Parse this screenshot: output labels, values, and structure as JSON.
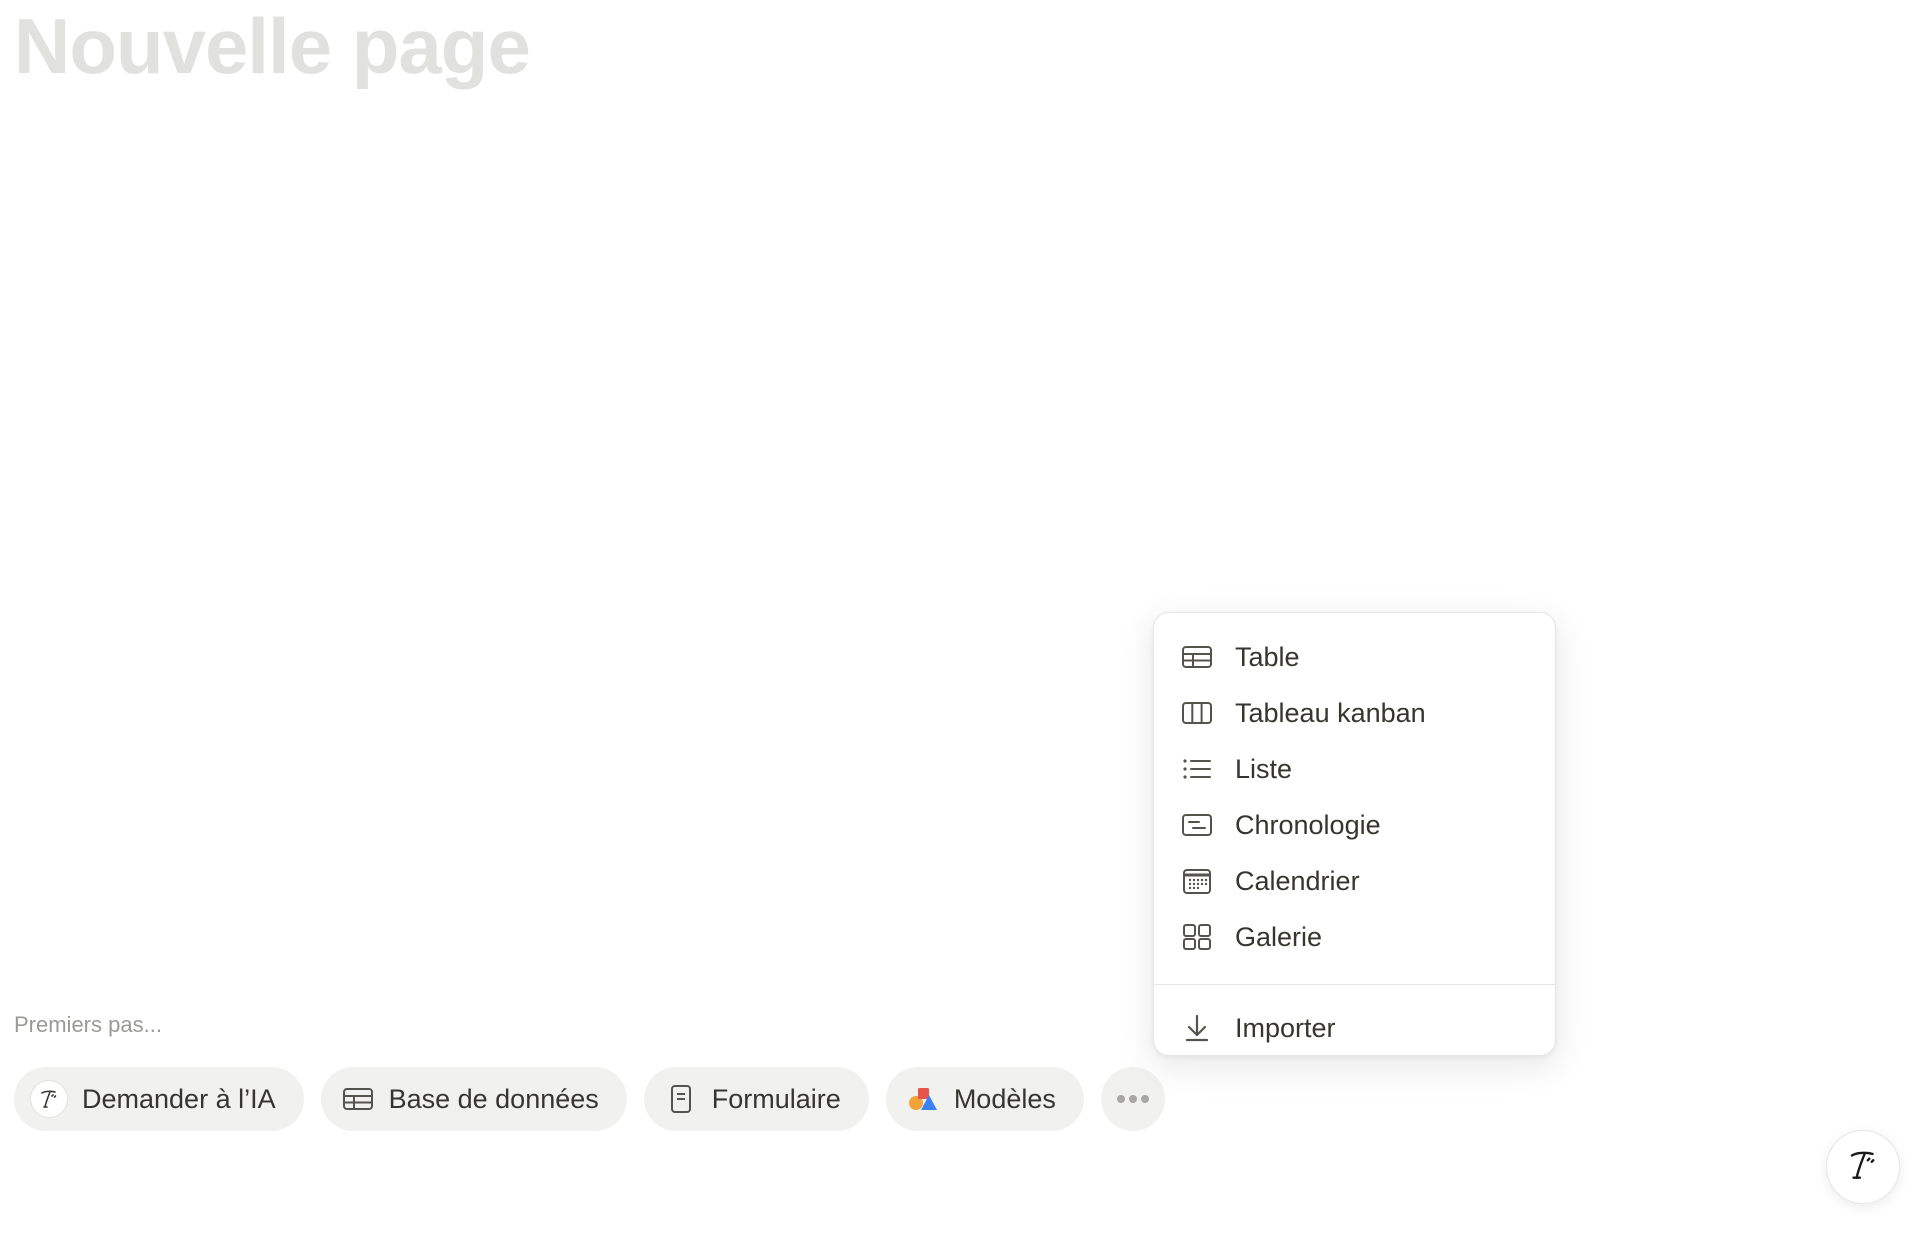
{
  "page": {
    "title": "Nouvelle page",
    "getting_started_label": "Premiers pas..."
  },
  "chips": [
    {
      "label": "Demander à l’IA",
      "icon": "ai-face-icon"
    },
    {
      "label": "Base de données",
      "icon": "table-icon"
    },
    {
      "label": "Formulaire",
      "icon": "form-icon"
    },
    {
      "label": "Modèles",
      "icon": "templates-icon"
    }
  ],
  "more_button": {
    "icon": "more-dots-icon"
  },
  "menu": {
    "items": [
      {
        "label": "Table",
        "icon": "table-icon"
      },
      {
        "label": "Tableau kanban",
        "icon": "board-icon"
      },
      {
        "label": "Liste",
        "icon": "list-icon"
      },
      {
        "label": "Chronologie",
        "icon": "timeline-icon"
      },
      {
        "label": "Calendrier",
        "icon": "calendar-icon"
      },
      {
        "label": "Galerie",
        "icon": "gallery-icon"
      }
    ],
    "import": {
      "label": "Importer",
      "icon": "download-arrow-icon"
    }
  },
  "ai_fab": {
    "icon": "ai-face-icon"
  },
  "colors": {
    "text": "#37352f",
    "title_placeholder": "#e1e1e0",
    "muted": "#9b9a97",
    "chip_bg": "#f1f1ef",
    "icon_gray": "#55534e",
    "templates_orange": "#f2a33a",
    "templates_red": "#e5534b",
    "templates_blue": "#3b82f6"
  }
}
